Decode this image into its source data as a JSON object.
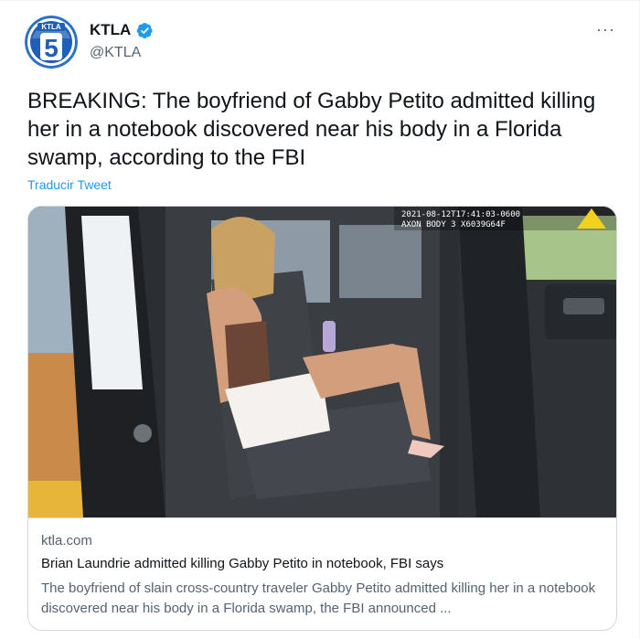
{
  "author": {
    "display_name": "KTLA",
    "handle": "@KTLA",
    "avatar_label": "5",
    "avatar_top_text": "KTLA",
    "verified": true,
    "verified_color": "#1d9bf0"
  },
  "menu": {
    "more_label": "···"
  },
  "tweet": {
    "text": "BREAKING: The boyfriend of Gabby Petito admitted killing her in a notebook discovered near his body in a Florida swamp, according to the FBI",
    "translate_label": "Traducir Tweet"
  },
  "card": {
    "image_overlay_line1": "2021-08-12T17:41:03-0600",
    "image_overlay_line2": "AXON BODY 3 X6039G64F",
    "domain": "ktla.com",
    "title": "Brian Laundrie admitted killing Gabby Petito in notebook, FBI says",
    "description": "The boyfriend of slain cross-country traveler Gabby Petito admitted killing her in a notebook discovered near his body in a Florida swamp, the FBI announced ..."
  },
  "colors": {
    "accent": "#1d9bf0",
    "text_primary": "#0f1419",
    "text_secondary": "#536471",
    "border": "#cfd9de"
  }
}
